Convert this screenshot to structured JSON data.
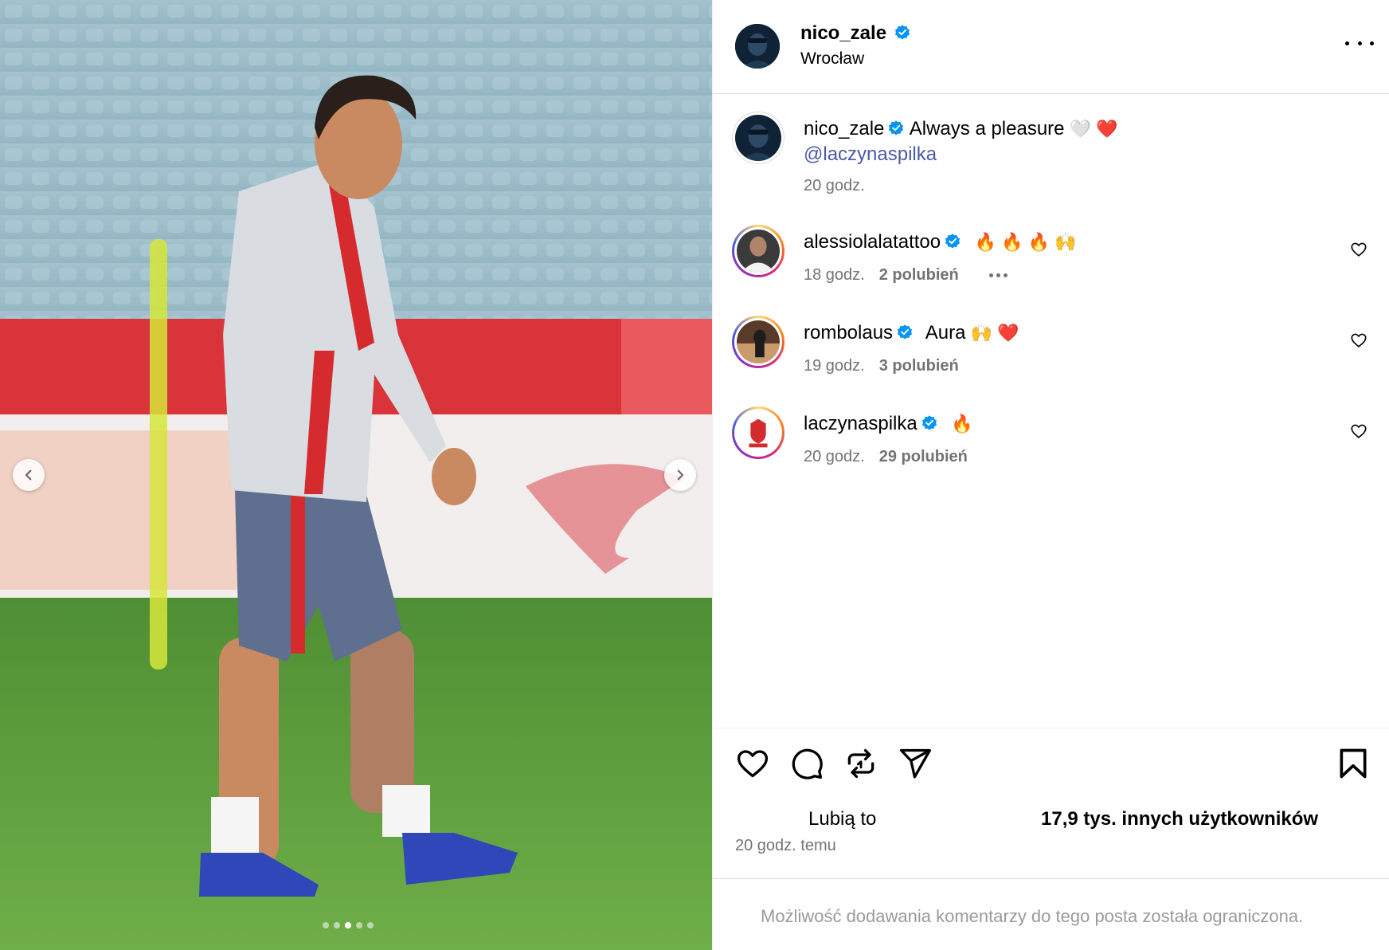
{
  "post": {
    "carousel": {
      "total_slides": 5,
      "active_slide": 3
    },
    "author": {
      "username": "nico_zale",
      "location": "Wrocław",
      "verified": true
    },
    "caption": {
      "username": "nico_zale",
      "text": "Always a pleasure",
      "emojis": "🤍 ❤️",
      "mention": "@laczynaspilka",
      "time": "20 godz."
    },
    "comments": [
      {
        "username": "alessiolalatattoo",
        "text": "",
        "emojis": "🔥 🔥 🔥 🙌",
        "time": "18 godz.",
        "likes": "2 polubień",
        "has_more": true
      },
      {
        "username": "rombolaus",
        "text": "Aura",
        "emojis": "🙌 ❤️",
        "time": "19 godz.",
        "likes": "3 polubień",
        "has_more": false
      },
      {
        "username": "laczynaspilka",
        "text": "",
        "emojis": "🔥",
        "time": "20 godz.",
        "likes": "29 polubień",
        "has_more": false
      }
    ],
    "likes_prefix": "Lubią to",
    "likes_count": "17,9 tys. innych użytkowników",
    "posted_ago": "20 godz. temu",
    "comments_disabled_msg": "Możliwość dodawania komentarzy do tego posta została ograniczona.",
    "icons": {
      "like": "heart-icon",
      "comment": "comment-icon",
      "repost": "repost-icon",
      "share": "send-icon",
      "save": "bookmark-icon",
      "more": "more-icon"
    },
    "colors": {
      "verified": "#0095f6",
      "mention": "#4a5aa6",
      "meta": "#737373"
    }
  }
}
